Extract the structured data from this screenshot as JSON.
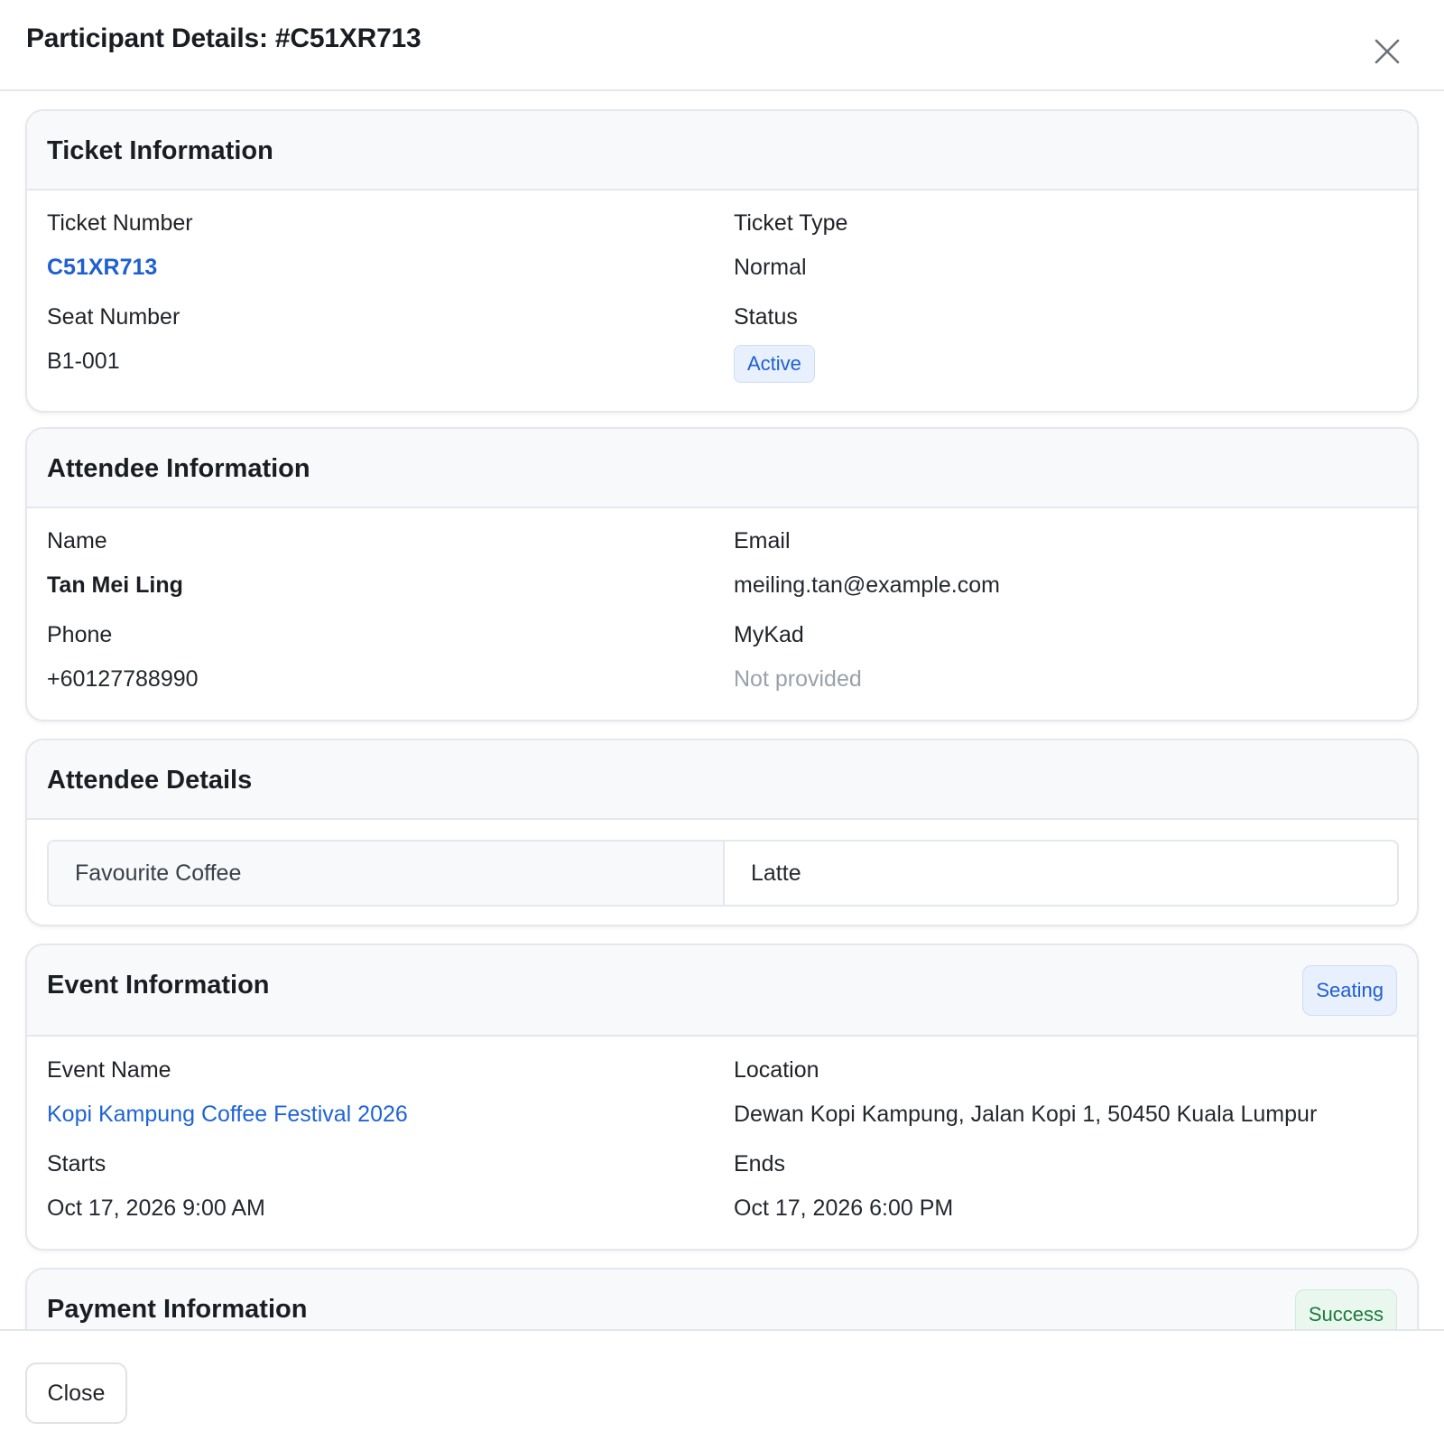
{
  "modal": {
    "title": "Participant Details: #C51XR713",
    "close_icon": "close-x-icon"
  },
  "ticket": {
    "title": "Ticket Information",
    "ticket_number_label": "Ticket Number",
    "ticket_number": "C51XR713",
    "ticket_type_label": "Ticket Type",
    "ticket_type": "Normal",
    "seat_number_label": "Seat Number",
    "seat_number": "B1-001",
    "status_label": "Status",
    "status": "Active"
  },
  "attendee": {
    "title": "Attendee Information",
    "name_label": "Name",
    "name": "Tan Mei Ling",
    "email_label": "Email",
    "email": "meiling.tan@example.com",
    "phone_label": "Phone",
    "phone": "+60127788990",
    "mykad_label": "MyKad",
    "mykad": "Not provided"
  },
  "details": {
    "title": "Attendee Details",
    "rows": [
      {
        "key": "Favourite Coffee",
        "value": "Latte"
      }
    ]
  },
  "event": {
    "title": "Event Information",
    "badge": "Seating",
    "event_name_label": "Event Name",
    "event_name": "Kopi Kampung Coffee Festival 2026",
    "location_label": "Location",
    "location": "Dewan Kopi Kampung, Jalan Kopi 1, 50450 Kuala Lumpur",
    "starts_label": "Starts",
    "starts": "Oct 17, 2026 9:00 AM",
    "ends_label": "Ends",
    "ends": "Oct 17, 2026 6:00 PM"
  },
  "payment": {
    "title": "Payment Information",
    "badge": "Success"
  },
  "footer": {
    "close_label": "Close"
  },
  "colors": {
    "link": "#1f5fd1",
    "badge_blue_bg": "#e8f0fd",
    "badge_green_text": "#1e7a3c",
    "border": "#e4e7eb",
    "header_bg": "#f8f9fb"
  }
}
